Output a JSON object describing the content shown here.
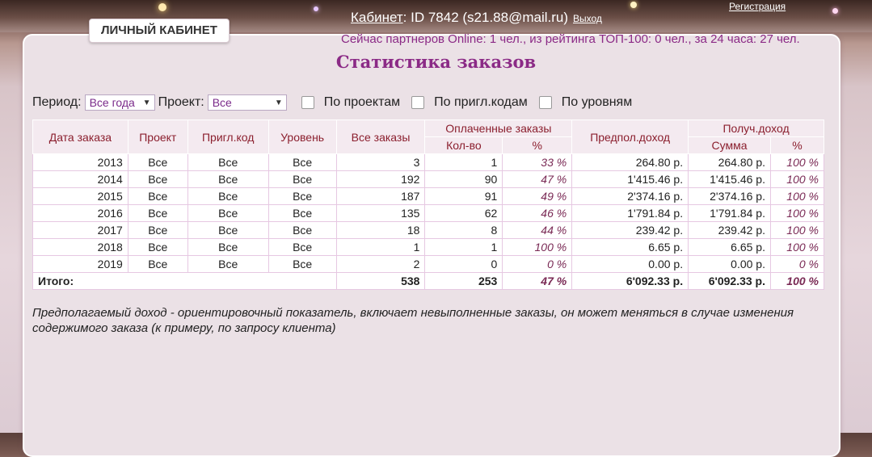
{
  "header": {
    "cabinet_label": "Кабинет",
    "cabinet_value": ": ID 7842 (s21.88@mail.ru)",
    "exit_label": "Выход",
    "register_label": "Регистрация"
  },
  "panel": {
    "tab_label": "ЛИЧНЫЙ КАБИНЕТ",
    "online_text": "Сейчас партнеров Online: 1 чел., из рейтинга ТОП-100: 0 чел., за 24 часа: 27 чел.",
    "title": "Статистика заказов"
  },
  "filters": {
    "period_label": "Период:",
    "period_value": "Все года",
    "project_label": "Проект:",
    "project_value": "Все",
    "by_projects": "По проектам",
    "by_invite_codes": "По пригл.кодам",
    "by_levels": "По уровням"
  },
  "table": {
    "headers": {
      "date": "Дата заказа",
      "project": "Проект",
      "invite_code": "Пригл.код",
      "level": "Уровень",
      "all_orders": "Все заказы",
      "paid_orders": "Оплаченные заказы",
      "paid_count": "Кол-во",
      "paid_pct": "%",
      "expected_income": "Предпол.доход",
      "received_income": "Получ.доход",
      "received_sum": "Сумма",
      "received_pct": "%"
    },
    "rows": [
      {
        "year": "2013",
        "project": "Все",
        "code": "Все",
        "level": "Все",
        "all": "3",
        "paid": "1",
        "paid_pct": "33 %",
        "expected": "264.80 р.",
        "received": "264.80 р.",
        "received_pct": "100 %"
      },
      {
        "year": "2014",
        "project": "Все",
        "code": "Все",
        "level": "Все",
        "all": "192",
        "paid": "90",
        "paid_pct": "47 %",
        "expected": "1'415.46 р.",
        "received": "1'415.46 р.",
        "received_pct": "100 %"
      },
      {
        "year": "2015",
        "project": "Все",
        "code": "Все",
        "level": "Все",
        "all": "187",
        "paid": "91",
        "paid_pct": "49 %",
        "expected": "2'374.16 р.",
        "received": "2'374.16 р.",
        "received_pct": "100 %"
      },
      {
        "year": "2016",
        "project": "Все",
        "code": "Все",
        "level": "Все",
        "all": "135",
        "paid": "62",
        "paid_pct": "46 %",
        "expected": "1'791.84 р.",
        "received": "1'791.84 р.",
        "received_pct": "100 %"
      },
      {
        "year": "2017",
        "project": "Все",
        "code": "Все",
        "level": "Все",
        "all": "18",
        "paid": "8",
        "paid_pct": "44 %",
        "expected": "239.42 р.",
        "received": "239.42 р.",
        "received_pct": "100 %"
      },
      {
        "year": "2018",
        "project": "Все",
        "code": "Все",
        "level": "Все",
        "all": "1",
        "paid": "1",
        "paid_pct": "100 %",
        "expected": "6.65 р.",
        "received": "6.65 р.",
        "received_pct": "100 %"
      },
      {
        "year": "2019",
        "project": "Все",
        "code": "Все",
        "level": "Все",
        "all": "2",
        "paid": "0",
        "paid_pct": "0 %",
        "expected": "0.00 р.",
        "received": "0.00 р.",
        "received_pct": "0 %"
      }
    ],
    "total": {
      "label": "Итого:",
      "all": "538",
      "paid": "253",
      "paid_pct": "47 %",
      "expected": "6'092.33 р.",
      "received": "6'092.33 р.",
      "received_pct": "100 %"
    }
  },
  "note": "Предполагаемый доход - ориентировочный показатель, включает невыполненные заказы, он может меняться в случае изменения содержимого заказа (к примеру, по запросу клиента)",
  "colors": {
    "accent": "#8b2a86",
    "header_text": "#8b1f2e"
  }
}
